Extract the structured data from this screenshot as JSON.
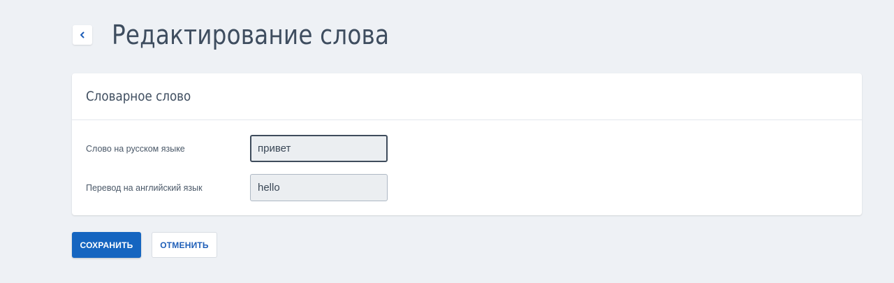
{
  "header": {
    "back_icon": "chevron-left-icon",
    "title": "Редактирование слова"
  },
  "card": {
    "title": "Словарное слово",
    "fields": [
      {
        "label": "Слово на русском языке",
        "value": "привет"
      },
      {
        "label": "Перевод на английский язык",
        "value": "hello"
      }
    ]
  },
  "actions": {
    "save_label": "СОХРАНИТЬ",
    "cancel_label": "ОТМЕНИТЬ"
  },
  "colors": {
    "background": "#eef1f5",
    "primary": "#1565c0",
    "secondary_text": "#1f5fb8"
  }
}
